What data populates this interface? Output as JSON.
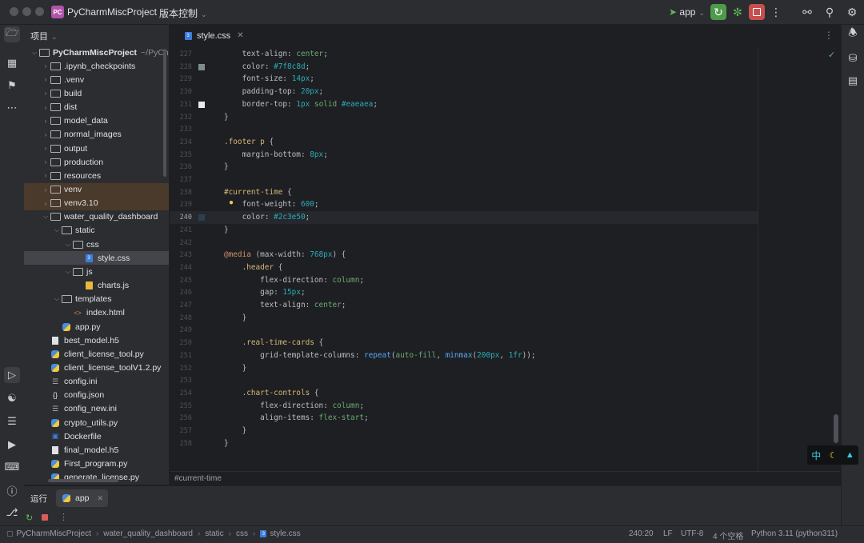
{
  "titlebar": {
    "project_badge": "PC",
    "project_name": "PyCharmMiscProject",
    "vcs_label": "版本控制",
    "run_config": "app"
  },
  "project_panel": {
    "title": "项目",
    "tree": [
      {
        "label": "PyCharmMiscProject",
        "suffix": "~/PyCha",
        "depth": 0,
        "kind": "folder",
        "expanded": true
      },
      {
        "label": ".ipynb_checkpoints",
        "depth": 1,
        "kind": "folder"
      },
      {
        "label": ".venv",
        "depth": 1,
        "kind": "folder"
      },
      {
        "label": "build",
        "depth": 1,
        "kind": "folder"
      },
      {
        "label": "dist",
        "depth": 1,
        "kind": "folder"
      },
      {
        "label": "model_data",
        "depth": 1,
        "kind": "folder"
      },
      {
        "label": "normal_images",
        "depth": 1,
        "kind": "folder"
      },
      {
        "label": "output",
        "depth": 1,
        "kind": "folder"
      },
      {
        "label": "production",
        "depth": 1,
        "kind": "folder"
      },
      {
        "label": "resources",
        "depth": 1,
        "kind": "folder"
      },
      {
        "label": "venv",
        "depth": 1,
        "kind": "folder",
        "highlight": true
      },
      {
        "label": "venv3.10",
        "depth": 1,
        "kind": "folder",
        "highlight": true
      },
      {
        "label": "water_quality_dashboard",
        "depth": 1,
        "kind": "folder",
        "expanded": true
      },
      {
        "label": "static",
        "depth": 2,
        "kind": "folder",
        "expanded": true
      },
      {
        "label": "css",
        "depth": 3,
        "kind": "folder",
        "expanded": true
      },
      {
        "label": "style.css",
        "depth": 4,
        "kind": "css",
        "selected": true
      },
      {
        "label": "js",
        "depth": 3,
        "kind": "folder",
        "expanded": true
      },
      {
        "label": "charts.js",
        "depth": 4,
        "kind": "js"
      },
      {
        "label": "templates",
        "depth": 2,
        "kind": "folder",
        "expanded": true
      },
      {
        "label": "index.html",
        "depth": 3,
        "kind": "html"
      },
      {
        "label": "app.py",
        "depth": 2,
        "kind": "py"
      },
      {
        "label": "best_model.h5",
        "depth": 1,
        "kind": "file"
      },
      {
        "label": "client_license_tool.py",
        "depth": 1,
        "kind": "py"
      },
      {
        "label": "client_license_toolV1.2.py",
        "depth": 1,
        "kind": "py"
      },
      {
        "label": "config.ini",
        "depth": 1,
        "kind": "ini"
      },
      {
        "label": "config.json",
        "depth": 1,
        "kind": "json"
      },
      {
        "label": "config_new.ini",
        "depth": 1,
        "kind": "ini"
      },
      {
        "label": "crypto_utils.py",
        "depth": 1,
        "kind": "py"
      },
      {
        "label": "Dockerfile",
        "depth": 1,
        "kind": "docker"
      },
      {
        "label": "final_model.h5",
        "depth": 1,
        "kind": "file"
      },
      {
        "label": "First_program.py",
        "depth": 1,
        "kind": "py"
      },
      {
        "label": "generate_license.py",
        "depth": 1,
        "kind": "py"
      }
    ]
  },
  "editor": {
    "tab_label": "style.css",
    "lines": [
      {
        "n": "227",
        "text": "    text-align: center;"
      },
      {
        "n": "228",
        "text": "    color: #7f8c8d;",
        "swatch": "#7f8c8d"
      },
      {
        "n": "229",
        "text": "    font-size: 14px;"
      },
      {
        "n": "230",
        "text": "    padding-top: 20px;"
      },
      {
        "n": "231",
        "text": "    border-top: 1px solid #eaeaea;",
        "swatch": "#eaeaea"
      },
      {
        "n": "232",
        "text": "}"
      },
      {
        "n": "233",
        "text": ""
      },
      {
        "n": "234",
        "text": ".footer p {"
      },
      {
        "n": "235",
        "text": "    margin-bottom: 8px;"
      },
      {
        "n": "236",
        "text": "}"
      },
      {
        "n": "237",
        "text": ""
      },
      {
        "n": "238",
        "text": "#current-time {"
      },
      {
        "n": "239",
        "text": "    font-weight: 600;"
      },
      {
        "n": "240",
        "text": "    color: #2c3e50;",
        "swatch": "#2c3e50",
        "current": true
      },
      {
        "n": "241",
        "text": "}"
      },
      {
        "n": "242",
        "text": ""
      },
      {
        "n": "243",
        "text": "@media (max-width: 768px) {"
      },
      {
        "n": "244",
        "text": "    .header {"
      },
      {
        "n": "245",
        "text": "        flex-direction: column;"
      },
      {
        "n": "246",
        "text": "        gap: 15px;"
      },
      {
        "n": "247",
        "text": "        text-align: center;"
      },
      {
        "n": "248",
        "text": "    }"
      },
      {
        "n": "249",
        "text": ""
      },
      {
        "n": "250",
        "text": "    .real-time-cards {"
      },
      {
        "n": "251",
        "text": "        grid-template-columns: repeat(auto-fill, minmax(200px, 1fr));"
      },
      {
        "n": "252",
        "text": "    }"
      },
      {
        "n": "253",
        "text": ""
      },
      {
        "n": "254",
        "text": "    .chart-controls {"
      },
      {
        "n": "255",
        "text": "        flex-direction: column;"
      },
      {
        "n": "256",
        "text": "        align-items: flex-start;"
      },
      {
        "n": "257",
        "text": "    }"
      },
      {
        "n": "258",
        "text": "}"
      }
    ],
    "breadcrumb": "#current-time"
  },
  "run_panel": {
    "title": "运行",
    "tab_label": "app"
  },
  "ime": {
    "lang": "中"
  },
  "statusbar": {
    "path": [
      "PyCharmMiscProject",
      "water_quality_dashboard",
      "static",
      "css",
      "style.css"
    ],
    "position": "240:20",
    "line_sep": "LF",
    "encoding": "UTF-8",
    "indent": "4 个空格",
    "interpreter": "Python 3.11 (python311)"
  },
  "colors": {
    "accent": "#3574f0",
    "run_green": "#5fb85a",
    "stop_red": "#db5c5c",
    "string_green": "#6aab73",
    "number_blue": "#2aacb8",
    "keyword_orange": "#cf8e6d",
    "selector_yellow": "#d5b778"
  }
}
